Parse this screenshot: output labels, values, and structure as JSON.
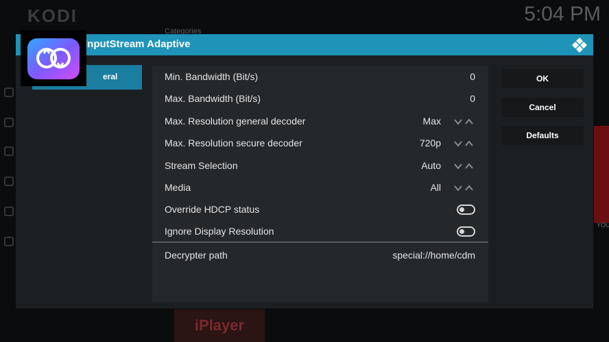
{
  "background": {
    "logo": "KODI",
    "clock": "5:04 PM",
    "categories_label": "Categories",
    "right_caption": "YOU",
    "bottom_tile_text": "iPlayer"
  },
  "dialog": {
    "title": "InputStream Adaptive",
    "category_selected": "General",
    "category_visible_text": "eral",
    "settings": [
      {
        "label": "Min. Bandwidth (Bit/s)",
        "value": "0",
        "control": "value"
      },
      {
        "label": "Max. Bandwidth (Bit/s)",
        "value": "0",
        "control": "value"
      },
      {
        "label": "Max. Resolution general decoder",
        "value": "Max",
        "control": "spinner"
      },
      {
        "label": "Max. Resolution secure decoder",
        "value": "720p",
        "control": "spinner"
      },
      {
        "label": "Stream Selection",
        "value": "Auto",
        "control": "spinner"
      },
      {
        "label": "Media",
        "value": "All",
        "control": "spinner"
      },
      {
        "label": "Override HDCP status",
        "value": "off",
        "control": "toggle"
      },
      {
        "label": "Ignore Display Resolution",
        "value": "off",
        "control": "toggle"
      }
    ],
    "path_setting": {
      "label": "Decrypter path",
      "value": "special://home/cdm"
    },
    "buttons": {
      "ok": "OK",
      "cancel": "Cancel",
      "defaults": "Defaults"
    }
  },
  "colors": {
    "accent": "#1f93b8",
    "selected_category": "#1b7da0",
    "panel": "#25282b",
    "dialog": "#1c1f22"
  },
  "icons": {
    "addon": "inputstream-adaptive-icon",
    "kodi": "kodi-logo-icon",
    "spinner": "chevron-down-up-icon",
    "toggle": "toggle-switch-icon"
  }
}
